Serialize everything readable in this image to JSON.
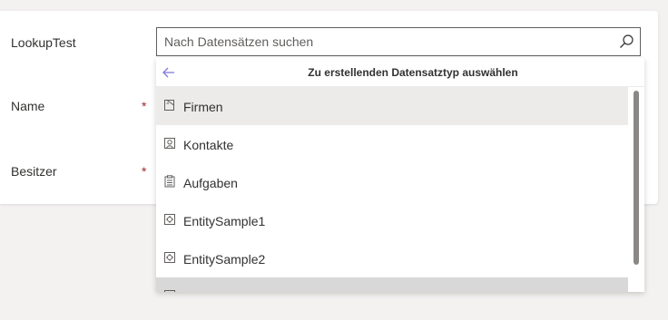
{
  "form": {
    "fields": [
      {
        "label": "LookupTest",
        "required": false
      },
      {
        "label": "Name",
        "required": true,
        "required_marker": "*"
      },
      {
        "label": "Besitzer",
        "required": true,
        "required_marker": "*"
      }
    ]
  },
  "lookup": {
    "search_placeholder": "Nach Datensätzen suchen",
    "search_value": "",
    "search_icon": "search-icon"
  },
  "flyout": {
    "back_icon": "back-arrow-icon",
    "title": "Zu erstellenden Datensatztyp auswählen",
    "items": [
      {
        "label": "Firmen",
        "icon": "account-icon",
        "state": "hovered"
      },
      {
        "label": "Kontakte",
        "icon": "contact-icon",
        "state": "normal"
      },
      {
        "label": "Aufgaben",
        "icon": "task-icon",
        "state": "normal"
      },
      {
        "label": "EntitySample1",
        "icon": "custom-entity-icon",
        "state": "normal"
      },
      {
        "label": "EntitySample2",
        "icon": "custom-entity-icon",
        "state": "normal"
      },
      {
        "label": "",
        "icon": "entity-icon",
        "state": "partial"
      }
    ]
  },
  "colors": {
    "required": "#a4262c",
    "hover_bg": "#edebe9",
    "border": "#605e5c",
    "back_arrow": "#8378de",
    "scrollbar": "#8a8886"
  }
}
